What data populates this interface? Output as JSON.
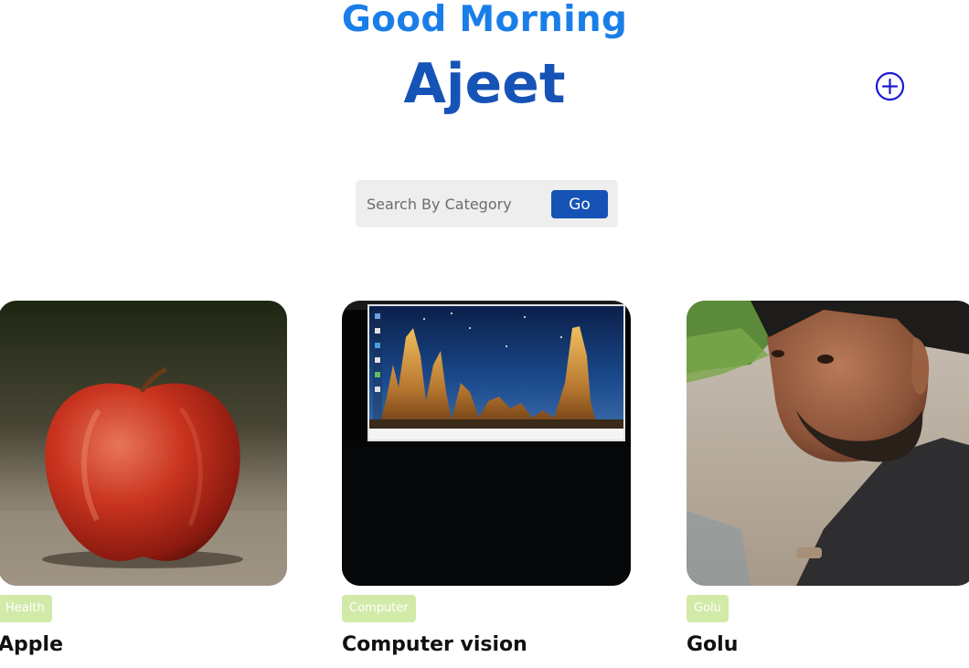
{
  "header": {
    "greeting": "Good Morning",
    "username": "Ajeet",
    "add_icon": "plus-circle-icon"
  },
  "search": {
    "placeholder": "Search By Category",
    "value": "",
    "button_label": "Go"
  },
  "colors": {
    "greeting": "#1a7ee8",
    "username": "#1653b7",
    "accent": "#1653b7",
    "add_icon": "#1a1ad0",
    "tag_bg": "#d2eaa8",
    "tag_text": "#ffffff"
  },
  "posts": [
    {
      "category": "Health",
      "title": "Apple",
      "image": "red-apple-photo"
    },
    {
      "category": "Computer",
      "title": "Computer vision",
      "image": "monitor-desktop-photo"
    },
    {
      "category": "Golu",
      "title": "Golu",
      "image": "man-portrait-photo"
    }
  ]
}
